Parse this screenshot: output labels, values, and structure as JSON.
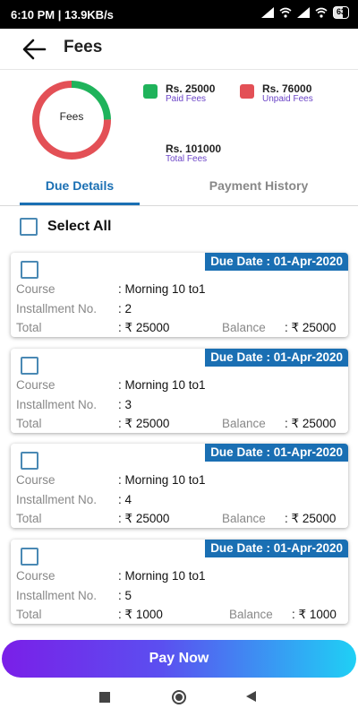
{
  "status_bar": {
    "time_speed": "6:10 PM | 13.9KB/s",
    "battery": "63"
  },
  "header": {
    "title": "Fees",
    "back_icon": "arrow-left-icon"
  },
  "summary": {
    "donut_label": "Fees",
    "paid": {
      "amount": "Rs. 25000",
      "label": "Paid Fees",
      "color": "#1fb35b",
      "value": 25000
    },
    "unpaid": {
      "amount": "Rs. 76000",
      "label": "Unpaid Fees",
      "color": "#e35056",
      "value": 76000
    },
    "total": {
      "amount": "Rs. 101000",
      "label": "Total Fees"
    }
  },
  "tabs": [
    {
      "label": "Due Details",
      "active": true
    },
    {
      "label": "Payment History",
      "active": false
    }
  ],
  "select_all": {
    "label": "Select All"
  },
  "labels": {
    "course": "Course",
    "installment": "Installment No.",
    "total": "Total",
    "balance": "Balance"
  },
  "dues": [
    {
      "due_date": "Due Date : 01-Apr-2020",
      "course": ": Morning 10 to1",
      "installment": ": 2",
      "total": ": ₹ 25000",
      "balance": ": ₹ 25000"
    },
    {
      "due_date": "Due Date : 01-Apr-2020",
      "course": ": Morning 10 to1",
      "installment": ": 3",
      "total": ": ₹ 25000",
      "balance": ": ₹ 25000"
    },
    {
      "due_date": "Due Date : 01-Apr-2020",
      "course": ": Morning 10 to1",
      "installment": ": 4",
      "total": ": ₹ 25000",
      "balance": ": ₹ 25000"
    },
    {
      "due_date": "Due Date : 01-Apr-2020",
      "course": ": Morning 10 to1",
      "installment": ": 5",
      "total": ": ₹ 1000",
      "balance": ": ₹ 1000"
    }
  ],
  "pay_button": {
    "label": "Pay Now"
  },
  "nav": {
    "recents_icon": "square-icon",
    "home_icon": "circle-icon",
    "back_icon": "triangle-back-icon"
  }
}
